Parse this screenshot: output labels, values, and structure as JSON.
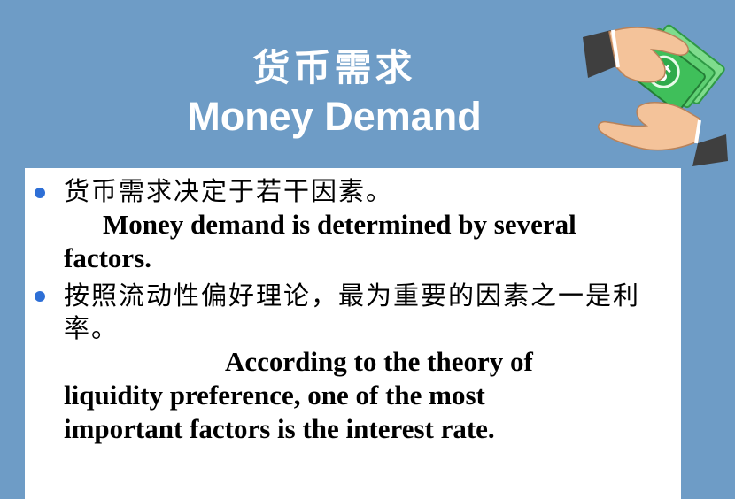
{
  "header": {
    "title_cn": "货币需求",
    "title_en": "Money Demand"
  },
  "illustration": {
    "icon": "hands-exchanging-money-icon"
  },
  "content": {
    "bullets": [
      {
        "cn": "货币需求决定于若干因素。",
        "en": "Money demand is determined by several factors."
      },
      {
        "cn": "按照流动性偏好理论，最为重要的因素之一是利率。",
        "en": "According to the theory of liquidity preference, one of the most important factors is the interest rate."
      }
    ]
  },
  "colors": {
    "background": "#6e9cc6",
    "panel": "#ffffff",
    "bullet": "#2e6fd6",
    "money": "#3fbf5a"
  }
}
